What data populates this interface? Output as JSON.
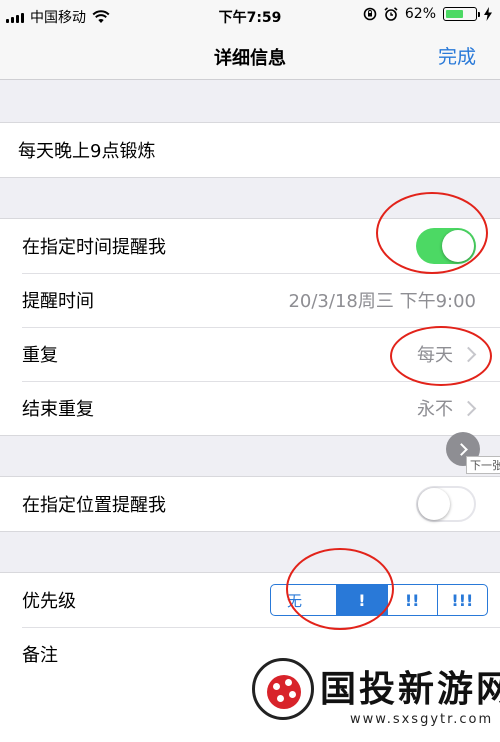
{
  "status_bar": {
    "carrier": "中国移动",
    "time": "下午7:59",
    "battery_percent": "62%",
    "battery_level": 0.62,
    "icons": [
      "signal-icon",
      "wifi-icon",
      "orientation-lock-icon",
      "alarm-icon",
      "battery-icon",
      "charging-icon"
    ]
  },
  "nav": {
    "title": "详细信息",
    "done": "完成"
  },
  "task": {
    "title": "每天晚上9点锻炼"
  },
  "reminder": {
    "remind_on_day_label": "在指定时间提醒我",
    "remind_on_day_enabled": true,
    "alarm_label": "提醒时间",
    "alarm_value": "20/3/18周三 下午9:00",
    "repeat_label": "重复",
    "repeat_value": "每天",
    "end_repeat_label": "结束重复",
    "end_repeat_value": "永不"
  },
  "location": {
    "label": "在指定位置提醒我",
    "enabled": false
  },
  "priority": {
    "label": "优先级",
    "options": [
      "无",
      "!",
      "!!",
      "!!!"
    ],
    "selected_index": 1
  },
  "notes": {
    "label": "备注"
  },
  "overlay": {
    "next_tip": "下一张"
  },
  "watermark": {
    "text": "国投新游网",
    "url": "www.sxsgytr.com"
  },
  "colors": {
    "accent": "#2979d8",
    "toggle_on": "#4cd964",
    "annotation_ring": "#e2231a"
  }
}
